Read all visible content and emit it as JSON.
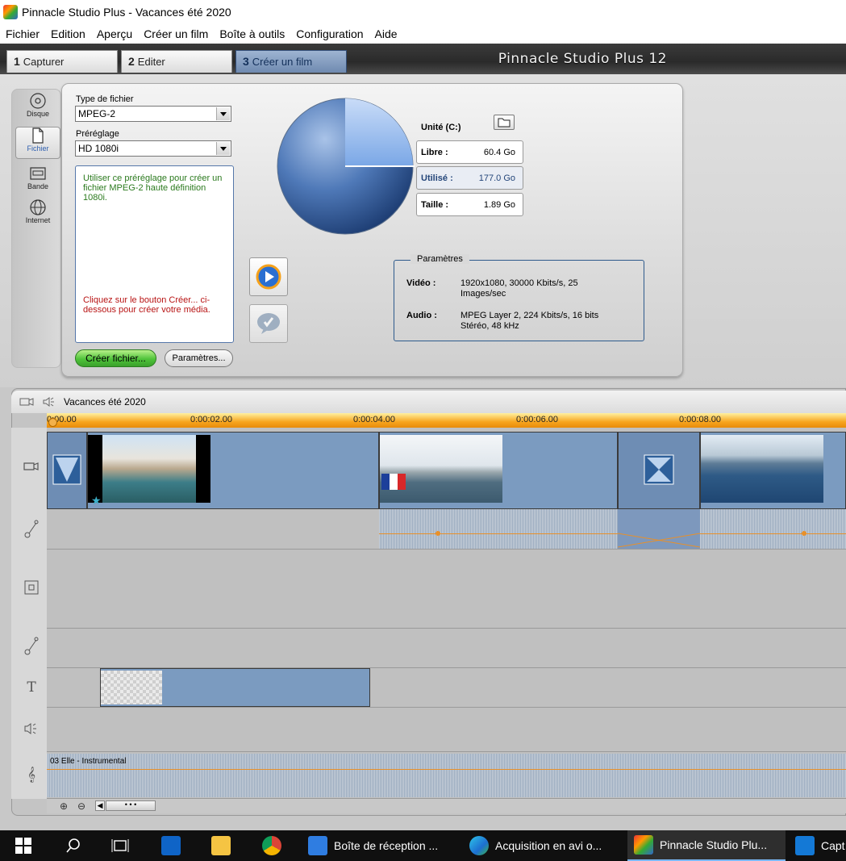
{
  "window": {
    "title": "Pinnacle Studio Plus - Vacances été 2020"
  },
  "menu": [
    "Fichier",
    "Edition",
    "Aperçu",
    "Créer un film",
    "Boîte à outils",
    "Configuration",
    "Aide"
  ],
  "tabs": [
    {
      "num": "1",
      "label": "Capturer"
    },
    {
      "num": "2",
      "label": "Editer"
    },
    {
      "num": "3",
      "label": "Créer un film"
    }
  ],
  "brand": "Pinnacle Studio Plus 12",
  "sidebar": [
    {
      "label": "Disque",
      "icon": "disc-icon"
    },
    {
      "label": "Fichier",
      "icon": "file-icon"
    },
    {
      "label": "Bande",
      "icon": "tape-icon"
    },
    {
      "label": "Internet",
      "icon": "globe-icon"
    }
  ],
  "output": {
    "file_type_label": "Type de fichier",
    "file_type_value": "MPEG-2",
    "preset_label": "Préréglage",
    "preset_value": "HD 1080i",
    "description": "Utiliser ce préréglage pour créer un fichier MPEG-2 haute définition 1080i.",
    "hint": "Cliquez sur le bouton Créer... ci-dessous pour créer votre média.",
    "create_button": "Créer fichier...",
    "params_button": "Paramètres..."
  },
  "disk": {
    "unit_label": "Unité (C:)",
    "free_label": "Libre :",
    "free_value": "60.4 Go",
    "used_label": "Utilisé :",
    "used_value": "177.0 Go",
    "size_label": "Taille :",
    "size_value": "1.89 Go",
    "free_fraction": 0.25
  },
  "parameters": {
    "legend": "Paramètres",
    "video_label": "Vidéo :",
    "video_value": "1920x1080, 30000 Kbits/s, 25 Images/sec",
    "audio_label": "Audio :",
    "audio_value": "MPEG Layer 2, 224 Kbits/s, 16 bits Stéréo, 48 kHz"
  },
  "timeline": {
    "project_name": "Vacances été 2020",
    "ruler": [
      "0:00.00",
      "0:00:02.00",
      "0:00:04.00",
      "0:00:06.00",
      "0:00:08.00"
    ],
    "music_clip": "03 Elle - Instrumental"
  },
  "taskbar": {
    "items": [
      {
        "label": "Boîte de réception ..."
      },
      {
        "label": "Acquisition en avi o..."
      },
      {
        "label": "Pinnacle Studio Plu..."
      },
      {
        "label": "Capt"
      }
    ]
  },
  "colors": {
    "accent": "#4a6ea0",
    "create_green": "#4fc33a",
    "ruler_orange": "#f7a51e",
    "hint_red": "#b81414",
    "desc_green": "#2b7a1e"
  }
}
